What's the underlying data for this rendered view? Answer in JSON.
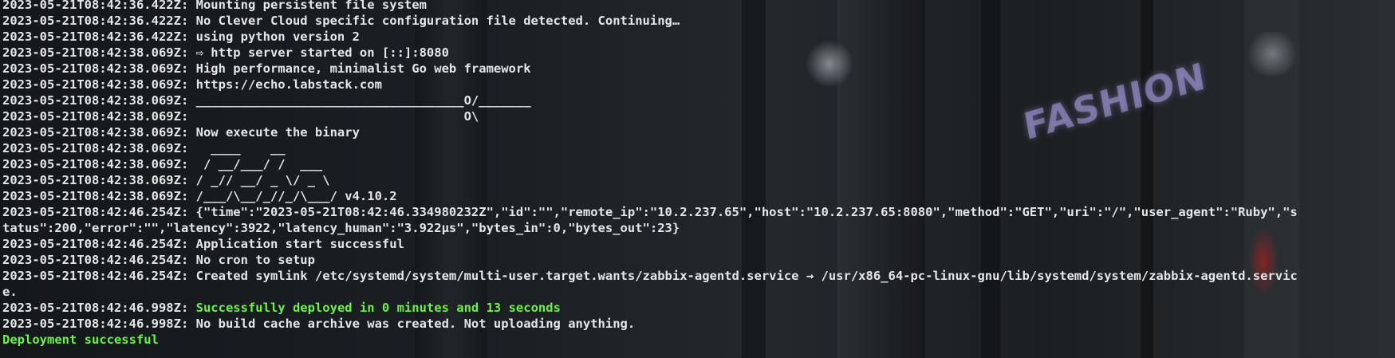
{
  "background": {
    "sign_text": "FASHION"
  },
  "terminal": {
    "lines": [
      "2023-05-21T08:42:36.422Z: Mounting persistent file system",
      "2023-05-21T08:42:36.422Z: No Clever Cloud specific configuration file detected. Continuing…",
      "2023-05-21T08:42:36.422Z: using python version 2",
      "2023-05-21T08:42:38.069Z: ⇨ http server started on [::]:8080",
      "2023-05-21T08:42:38.069Z: High performance, minimalist Go web framework",
      "2023-05-21T08:42:38.069Z: https://echo.labstack.com",
      "2023-05-21T08:42:38.069Z: ____________________________________O/_______",
      "2023-05-21T08:42:38.069Z:                                     O\\",
      "2023-05-21T08:42:38.069Z: Now execute the binary",
      "2023-05-21T08:42:38.069Z:   ____    __",
      "2023-05-21T08:42:38.069Z:  / __/___/ /  ___",
      "2023-05-21T08:42:38.069Z: / _// __/ _ \\/ _ \\",
      "2023-05-21T08:42:38.069Z: /___/\\__/_//_/\\___/ v4.10.2",
      "2023-05-21T08:42:46.254Z: {\"time\":\"2023-05-21T08:42:46.334980232Z\",\"id\":\"\",\"remote_ip\":\"10.2.237.65\",\"host\":\"10.2.237.65:8080\",\"method\":\"GET\",\"uri\":\"/\",\"user_agent\":\"Ruby\",\"s",
      "tatus\":200,\"error\":\"\",\"latency\":3922,\"latency_human\":\"3.922µs\",\"bytes_in\":0,\"bytes_out\":23}",
      "2023-05-21T08:42:46.254Z: Application start successful",
      "2023-05-21T08:42:46.254Z: No cron to setup",
      "2023-05-21T08:42:46.254Z: Created symlink /etc/systemd/system/multi-user.target.wants/zabbix-agentd.service → /usr/x86_64-pc-linux-gnu/lib/systemd/system/zabbix-agentd.servic",
      "e.",
      "2023-05-21T08:42:46.998Z: ",
      "2023-05-21T08:42:46.998Z: No build cache archive was created. Not uploading anything."
    ],
    "deploy_prefix": "2023-05-21T08:42:46.998Z: ",
    "deploy_message": "Successfully deployed in 0 minutes and 13 seconds",
    "final_line": "Deployment successful"
  },
  "colors": {
    "text": "#e4e6e8",
    "success": "#6ef04a"
  }
}
